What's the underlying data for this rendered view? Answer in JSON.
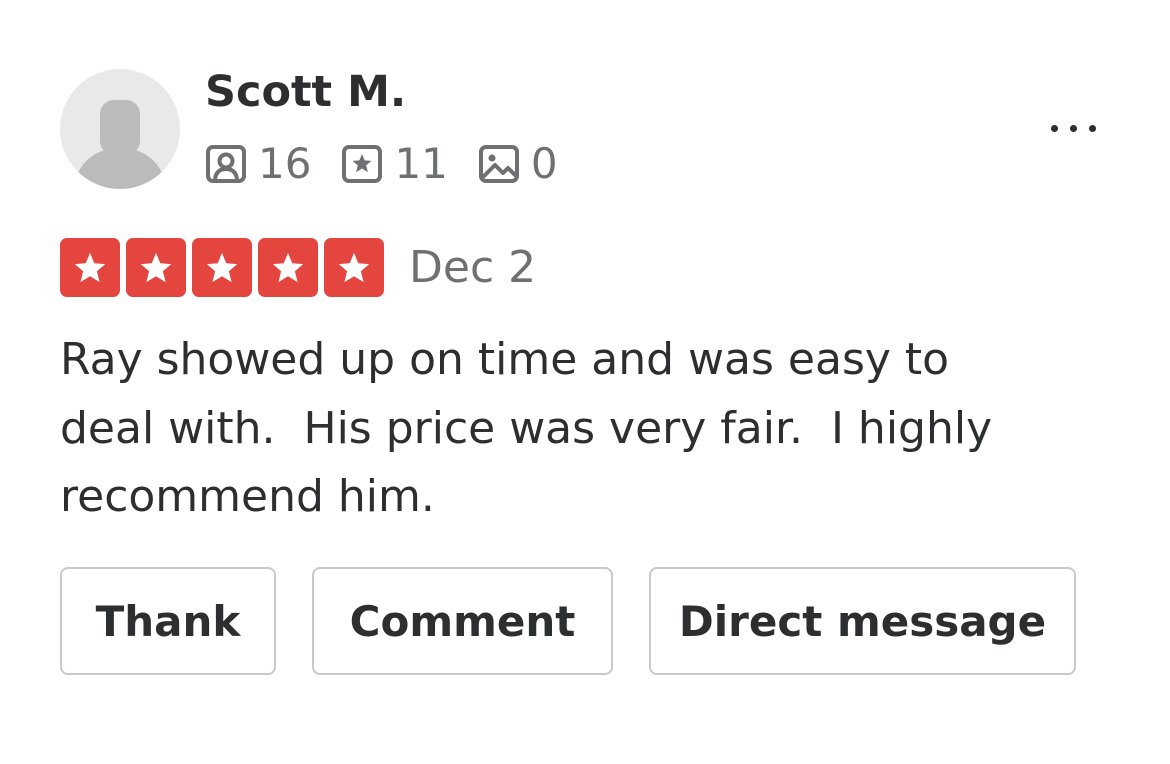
{
  "reviewer": {
    "name": "Scott M.",
    "stats": {
      "friends": "16",
      "reviews": "11",
      "photos": "0"
    }
  },
  "review": {
    "rating": 5,
    "max_rating": 5,
    "date": "Dec 2",
    "text": "Ray showed up on time and was easy to\ndeal with.  His price was very fair.  I highly\nrecommend him."
  },
  "actions": {
    "thank_label": "Thank",
    "comment_label": "Comment",
    "message_label": "Direct message"
  },
  "colors": {
    "star_fill": "#e4463f",
    "star_empty": "#e9e9eb",
    "text_primary": "#2d2e2f",
    "text_secondary": "#6e7072",
    "button_border": "#c8c9ca",
    "avatar_bg": "#e9e9eb",
    "avatar_figure": "#bbbbbd"
  },
  "icons": {
    "friends": "friends-icon",
    "reviews": "review-star-icon",
    "photos": "photo-icon",
    "more": "more-options-icon",
    "avatar": "default-avatar-icon"
  }
}
